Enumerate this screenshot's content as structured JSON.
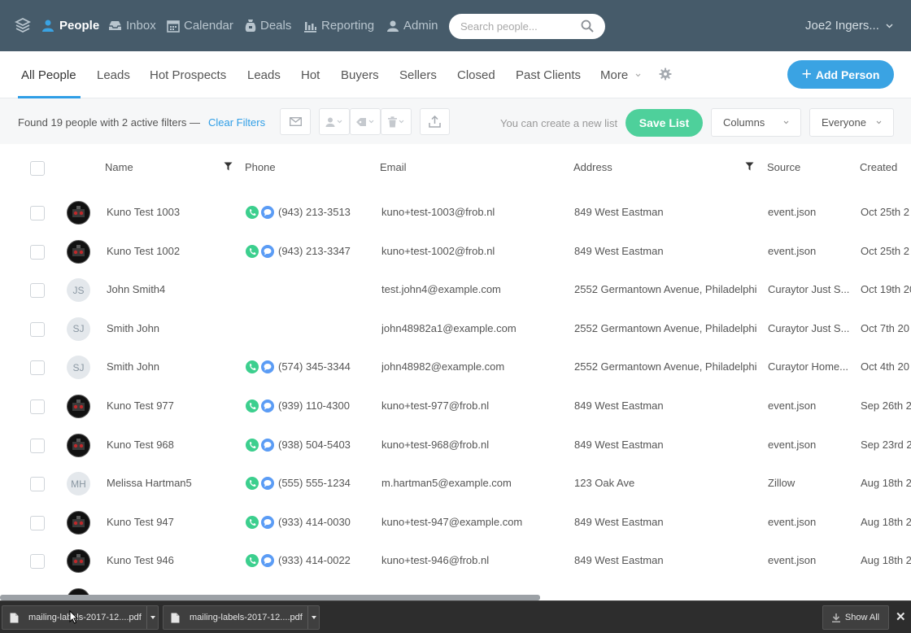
{
  "nav": {
    "logo_icon": "stack-layers-icon",
    "items": [
      {
        "label": "People",
        "icon": "person-icon",
        "active": true
      },
      {
        "label": "Inbox",
        "icon": "inbox-icon"
      },
      {
        "label": "Calendar",
        "icon": "calendar-icon"
      },
      {
        "label": "Deals",
        "icon": "deals-icon"
      },
      {
        "label": "Reporting",
        "icon": "bar-chart-icon"
      },
      {
        "label": "Admin",
        "icon": "admin-person-icon"
      }
    ],
    "search_placeholder": "Search people...",
    "user_name": "Joe2 Ingers..."
  },
  "tabs": [
    "All People",
    "Leads",
    "Hot Prospects",
    "Leads",
    "Hot",
    "Buyers",
    "Sellers",
    "Closed",
    "Past Clients",
    "More"
  ],
  "add_person_label": "Add Person",
  "toolbar": {
    "found_text": "Found 19 people with 2 active filters  —",
    "clear_filters": "Clear Filters",
    "hint": "You can create a new list",
    "save_list": "Save List",
    "columns": "Columns",
    "everyone": "Everyone"
  },
  "table": {
    "headers": [
      "Name",
      "Phone",
      "Email",
      "Address",
      "Source",
      "Created"
    ],
    "rows": [
      {
        "avatar": "image",
        "initials": "",
        "name": "Kuno Test 1003",
        "phone": "(943) 213-3513",
        "email": "kuno+test-1003@frob.nl",
        "address": "849 West Eastman",
        "source": "event.json",
        "created": "Oct 25th 2"
      },
      {
        "avatar": "image",
        "initials": "",
        "name": "Kuno Test 1002",
        "phone": "(943) 213-3347",
        "email": "kuno+test-1002@frob.nl",
        "address": "849 West Eastman",
        "source": "event.json",
        "created": "Oct 25th 2"
      },
      {
        "avatar": "initials",
        "initials": "JS",
        "name": "John Smith4",
        "phone": "",
        "email": "test.john4@example.com",
        "address": "2552 Germantown Avenue, Philadelphi",
        "source": "Curaytor Just S...",
        "created": "Oct 19th 20"
      },
      {
        "avatar": "initials",
        "initials": "SJ",
        "name": "Smith John",
        "phone": "",
        "email": "john48982a1@example.com",
        "address": "2552 Germantown Avenue, Philadelphi",
        "source": "Curaytor Just S...",
        "created": "Oct 7th 20"
      },
      {
        "avatar": "initials",
        "initials": "SJ",
        "name": "Smith John",
        "phone": "(574) 345-3344",
        "email": "john48982@example.com",
        "address": "2552 Germantown Avenue, Philadelphi",
        "source": "Curaytor Home...",
        "created": "Oct 4th 20"
      },
      {
        "avatar": "image",
        "initials": "",
        "name": "Kuno Test 977",
        "phone": "(939) 110-4300",
        "email": "kuno+test-977@frob.nl",
        "address": "849 West Eastman",
        "source": "event.json",
        "created": "Sep 26th 2"
      },
      {
        "avatar": "image",
        "initials": "",
        "name": "Kuno Test 968",
        "phone": "(938) 504-5403",
        "email": "kuno+test-968@frob.nl",
        "address": "849 West Eastman",
        "source": "event.json",
        "created": "Sep 23rd 2"
      },
      {
        "avatar": "initials",
        "initials": "MH",
        "name": "Melissa Hartman5",
        "phone": "(555) 555-1234",
        "email": "m.hartman5@example.com",
        "address": "123 Oak Ave",
        "source": "Zillow",
        "created": "Aug 18th 2"
      },
      {
        "avatar": "image",
        "initials": "",
        "name": "Kuno Test 947",
        "phone": "(933) 414-0030",
        "email": "kuno+test-947@example.com",
        "address": "849 West Eastman",
        "source": "event.json",
        "created": "Aug 18th 2"
      },
      {
        "avatar": "image",
        "initials": "",
        "name": "Kuno Test 946",
        "phone": "(933) 414-0022",
        "email": "kuno+test-946@frob.nl",
        "address": "849 West Eastman",
        "source": "event.json",
        "created": "Aug 18th 2"
      }
    ]
  },
  "downloads": {
    "items": [
      "mailing-labels-2017-12....pdf",
      "mailing-labels-2017-12....pdf"
    ],
    "show_all": "Show All"
  },
  "colors": {
    "nav_bg": "#465b6a",
    "accent_blue": "#3aa3e3",
    "save_green": "#4ed09b",
    "phone_green": "#3ccf8e",
    "sms_blue": "#5b9cf5"
  }
}
